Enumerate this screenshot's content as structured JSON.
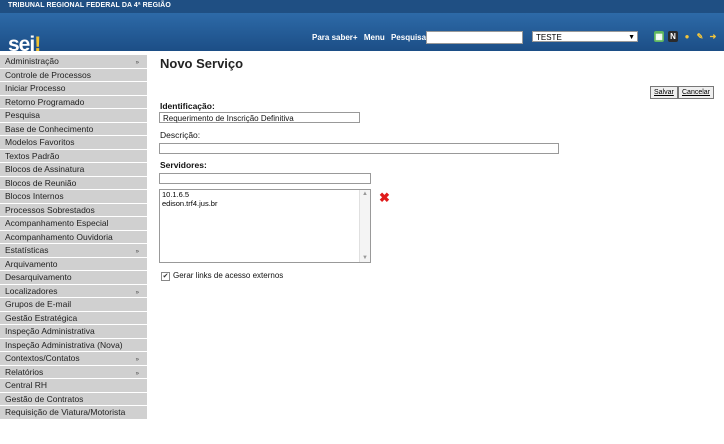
{
  "header": {
    "org_name": "TRIBUNAL REGIONAL FEDERAL DA 4ª REGIÃO",
    "logo_text": "sei",
    "logo_mark": "!",
    "links": [
      "Para saber+",
      "Menu",
      "Pesquisa"
    ],
    "search_value": "",
    "unit_selected": "TESTE"
  },
  "sidebar": {
    "items": [
      {
        "label": "Administração",
        "submenu": true
      },
      {
        "label": "Controle de Processos",
        "submenu": false
      },
      {
        "label": "Iniciar Processo",
        "submenu": false
      },
      {
        "label": "Retorno Programado",
        "submenu": false
      },
      {
        "label": "Pesquisa",
        "submenu": false
      },
      {
        "label": "Base de Conhecimento",
        "submenu": false
      },
      {
        "label": "Modelos Favoritos",
        "submenu": false
      },
      {
        "label": "Textos Padrão",
        "submenu": false
      },
      {
        "label": "Blocos de Assinatura",
        "submenu": false
      },
      {
        "label": "Blocos de Reunião",
        "submenu": false
      },
      {
        "label": "Blocos Internos",
        "submenu": false
      },
      {
        "label": "Processos Sobrestados",
        "submenu": false
      },
      {
        "label": "Acompanhamento Especial",
        "submenu": false
      },
      {
        "label": "Acompanhamento Ouvidoria",
        "submenu": false
      },
      {
        "label": "Estatísticas",
        "submenu": true
      },
      {
        "label": "Arquivamento",
        "submenu": false
      },
      {
        "label": "Desarquivamento",
        "submenu": false
      },
      {
        "label": "Localizadores",
        "submenu": true
      },
      {
        "label": "Grupos de E-mail",
        "submenu": false
      },
      {
        "label": "Gestão Estratégica",
        "submenu": false
      },
      {
        "label": "Inspeção Administrativa",
        "submenu": false
      },
      {
        "label": "Inspeção Administrativa (Nova)",
        "submenu": false
      },
      {
        "label": "Contextos/Contatos",
        "submenu": true
      },
      {
        "label": "Relatórios",
        "submenu": true
      },
      {
        "label": "Central RH",
        "submenu": false
      },
      {
        "label": "Gestão de Contratos",
        "submenu": false
      },
      {
        "label": "Requisição de Viatura/Motorista",
        "submenu": false
      }
    ]
  },
  "main": {
    "title": "Novo Serviço",
    "save_label": "Salvar",
    "cancel_label": "Cancelar",
    "identificacao_label": "Identificação:",
    "identificacao_value": "Requerimento de Inscrição Definitiva",
    "descricao_label": "Descrição:",
    "descricao_value": "",
    "servidores_label": "Servidores:",
    "servidores_input": "",
    "servidores_list": [
      "10.1.6.5",
      "edison.trf4.jus.br"
    ],
    "checkbox_checked": true,
    "checkbox_label": "Gerar links de acesso externos"
  },
  "colors": {
    "header_bg": "#1f4f83",
    "menu_bg": "#d0d0d0",
    "delete_icon": "#e01b1b"
  }
}
